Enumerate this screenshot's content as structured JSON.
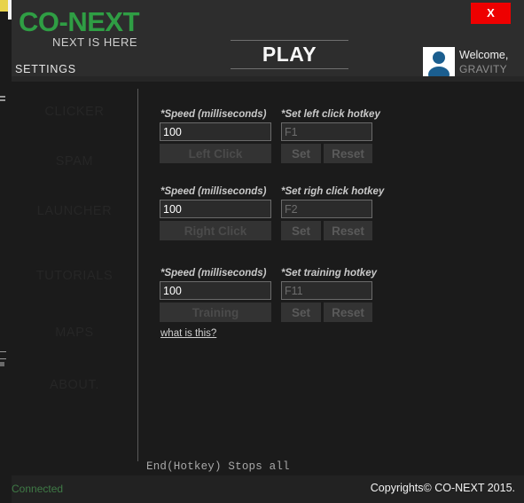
{
  "window": {
    "close_label": "X"
  },
  "header": {
    "brand_title": "CO-NEXT",
    "brand_sub": "NEXT IS HERE",
    "settings_label": "SETTINGS",
    "play_label": "PLAY",
    "welcome_label": "Welcome,",
    "username": "GRAVITY",
    "avatar_icon": "user-avatar-icon"
  },
  "sidebar": {
    "items": [
      {
        "label": "CLICKER"
      },
      {
        "label": "SPAM"
      },
      {
        "label": "LAUNCHER"
      },
      {
        "label": "TUTORIALS"
      },
      {
        "label": "MAPS"
      },
      {
        "label": "ABOUT."
      }
    ]
  },
  "content": {
    "groups": [
      {
        "speed_label": "*Speed (milliseconds)",
        "speed_value": "100",
        "action_label": "Left Click",
        "hotkey_label": "*Set left click hotkey",
        "hotkey_value": "F1",
        "set_label": "Set",
        "reset_label": "Reset"
      },
      {
        "speed_label": "*Speed (milliseconds)",
        "speed_value": "100",
        "action_label": "Right Click",
        "hotkey_label": "*Set righ click hotkey",
        "hotkey_value": "F2",
        "set_label": "Set",
        "reset_label": "Reset"
      },
      {
        "speed_label": "*Speed (milliseconds)",
        "speed_value": "100",
        "action_label": "Training",
        "hotkey_label": "*Set training hotkey",
        "hotkey_value": "F11",
        "set_label": "Set",
        "reset_label": "Reset"
      }
    ],
    "help_link": "what is this?",
    "hotkey_note": "End(Hotkey) Stops all"
  },
  "footer": {
    "status": "Connected",
    "copyright": "Copyrights© CO-NEXT 2015."
  },
  "colors": {
    "brand_green": "#2f9e44",
    "close_red": "#ee0000",
    "status_green": "#3f7a46",
    "app_bg": "#1b1b1b",
    "header_bg": "#2d2d2d",
    "footer_bg": "#222222"
  }
}
